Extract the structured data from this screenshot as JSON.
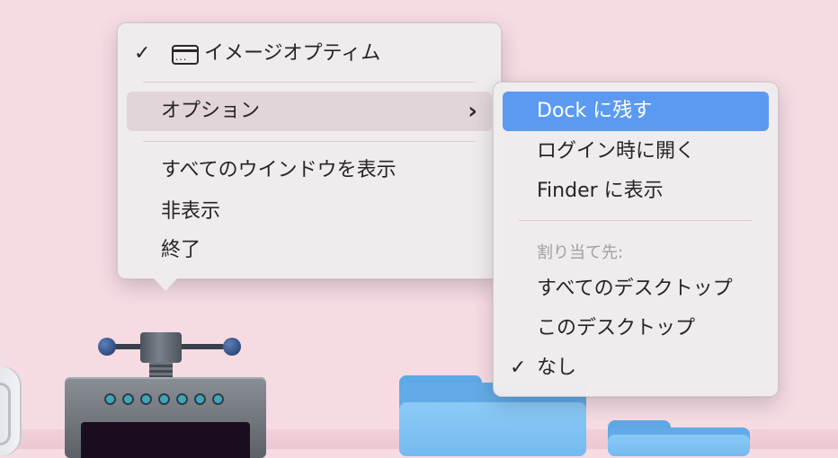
{
  "main_menu": {
    "app_name": "イメージオプティム",
    "app_checked": "✓",
    "options_label": "オプション",
    "options_chevron": "›",
    "show_all_windows": "すべてのウインドウを表示",
    "hide": "非表示",
    "quit": "終了"
  },
  "options_menu": {
    "keep_in_dock": "Dock に残す",
    "open_at_login": "ログイン時に開く",
    "show_in_finder": "Finder に表示",
    "assign_to_header": "割り当て先:",
    "all_desktops": "すべてのデスクトップ",
    "this_desktop": "このデスクトップ",
    "none": "なし",
    "none_checked": "✓"
  },
  "icons": {
    "app_window": "window-icon",
    "app_in_dock": "imageoptim-press-icon",
    "folders": "folder-icon"
  },
  "colors": {
    "desktop_bg": "#f6dbe3",
    "menu_bg": "#f0ecee",
    "highlight_blue": "#5b9af0",
    "highlight_gray": "#e1d5da",
    "folder_blue": "#74baf0"
  }
}
